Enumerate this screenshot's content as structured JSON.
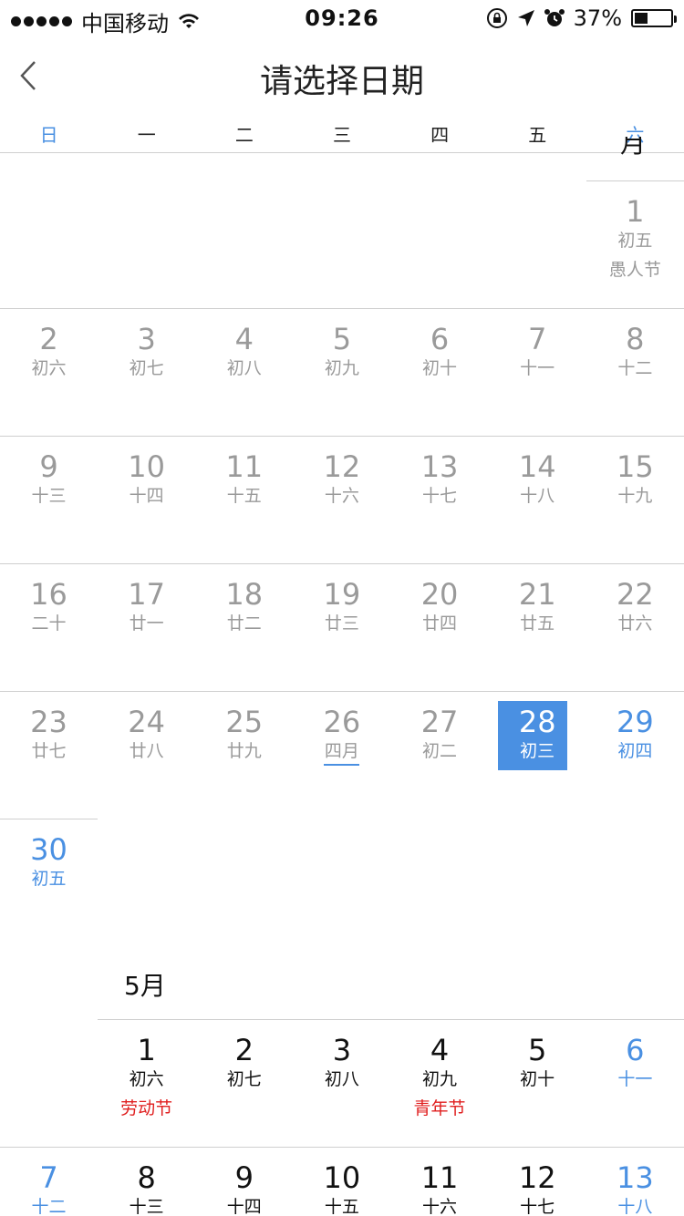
{
  "status_bar": {
    "carrier": "中国移动",
    "time": "09:26",
    "battery": "37%"
  },
  "nav": {
    "title": "请选择日期"
  },
  "weekdays": [
    "日",
    "一",
    "二",
    "三",
    "四",
    "五",
    "六"
  ],
  "months": [
    {
      "partial_header": "月",
      "days": [
        {
          "n": "1",
          "l": "初五",
          "h": "愚人节"
        },
        {
          "n": "2",
          "l": "初六"
        },
        {
          "n": "3",
          "l": "初七"
        },
        {
          "n": "4",
          "l": "初八"
        },
        {
          "n": "5",
          "l": "初九"
        },
        {
          "n": "6",
          "l": "初十"
        },
        {
          "n": "7",
          "l": "十一"
        },
        {
          "n": "8",
          "l": "十二"
        },
        {
          "n": "9",
          "l": "十三"
        },
        {
          "n": "10",
          "l": "十四"
        },
        {
          "n": "11",
          "l": "十五"
        },
        {
          "n": "12",
          "l": "十六"
        },
        {
          "n": "13",
          "l": "十七"
        },
        {
          "n": "14",
          "l": "十八"
        },
        {
          "n": "15",
          "l": "十九"
        },
        {
          "n": "16",
          "l": "二十"
        },
        {
          "n": "17",
          "l": "廿一"
        },
        {
          "n": "18",
          "l": "廿二"
        },
        {
          "n": "19",
          "l": "廿三"
        },
        {
          "n": "20",
          "l": "廿四"
        },
        {
          "n": "21",
          "l": "廿五"
        },
        {
          "n": "22",
          "l": "廿六"
        },
        {
          "n": "23",
          "l": "廿七"
        },
        {
          "n": "24",
          "l": "廿八"
        },
        {
          "n": "25",
          "l": "廿九"
        },
        {
          "n": "26",
          "l": "四月"
        },
        {
          "n": "27",
          "l": "初二"
        },
        {
          "n": "28",
          "l": "初三"
        },
        {
          "n": "29",
          "l": "初四"
        },
        {
          "n": "30",
          "l": "初五"
        }
      ],
      "selected_day": "28"
    },
    {
      "title": "5月",
      "days": [
        {
          "n": "1",
          "l": "初六",
          "h": "劳动节"
        },
        {
          "n": "2",
          "l": "初七"
        },
        {
          "n": "3",
          "l": "初八"
        },
        {
          "n": "4",
          "l": "初九",
          "h": "青年节"
        },
        {
          "n": "5",
          "l": "初十"
        },
        {
          "n": "6",
          "l": "十一"
        },
        {
          "n": "7",
          "l": "十二"
        },
        {
          "n": "8",
          "l": "十三"
        },
        {
          "n": "9",
          "l": "十四"
        },
        {
          "n": "10",
          "l": "十五"
        },
        {
          "n": "11",
          "l": "十六"
        },
        {
          "n": "12",
          "l": "十七"
        },
        {
          "n": "13",
          "l": "十八"
        }
      ]
    }
  ],
  "colors": {
    "accent": "#4a90e2",
    "holiday_red": "#e02020",
    "past_gray": "#9a9a9a"
  }
}
